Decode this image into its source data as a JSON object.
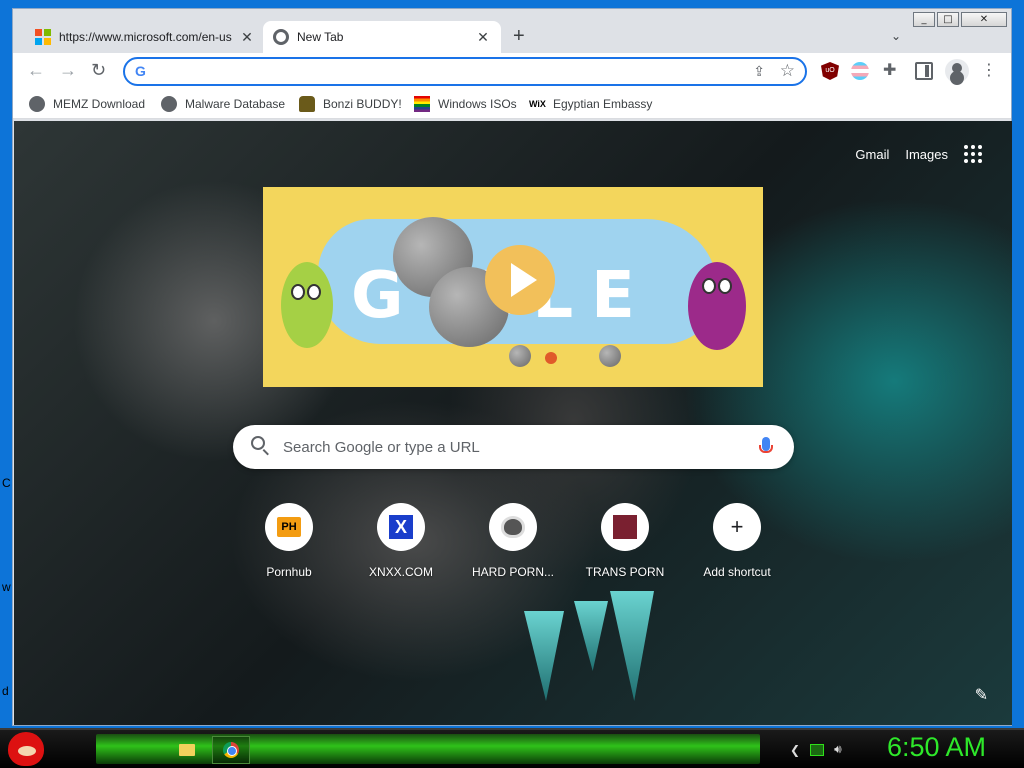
{
  "desktop": {
    "left_letters": [
      "C",
      "w",
      "d"
    ]
  },
  "window": {
    "controls": [
      "_",
      "□",
      "✕"
    ]
  },
  "tabs": [
    {
      "title": "https://www.microsoft.com/en-us",
      "active": false
    },
    {
      "title": "New Tab",
      "active": true
    }
  ],
  "omnibox": {
    "value": "",
    "placeholder": ""
  },
  "bookmarks": [
    {
      "label": "MEMZ Download",
      "icon": "globe-icon"
    },
    {
      "label": "Malware Database",
      "icon": "globe-icon"
    },
    {
      "label": "Bonzi BUDDY!",
      "icon": "bonzi-icon"
    },
    {
      "label": "Windows ISOs",
      "icon": "rainbow-flag-icon"
    },
    {
      "label": "Egyptian Embassy",
      "icon": "wix-icon"
    }
  ],
  "newtab": {
    "top_links": {
      "gmail": "Gmail",
      "images": "Images"
    },
    "search": {
      "placeholder": "Search Google or type a URL"
    },
    "shortcuts": [
      {
        "label": "Pornhub",
        "icon_text": "PH"
      },
      {
        "label": "XNXX.COM",
        "icon_text": "X"
      },
      {
        "label": "HARD PORN...",
        "icon_text": ""
      },
      {
        "label": "TRANS PORN",
        "icon_text": ""
      },
      {
        "label": "Add shortcut",
        "icon_text": "+"
      }
    ]
  },
  "taskbar": {
    "clock": "6:50 AM"
  },
  "colors": {
    "accent": "#1a73e8",
    "taskbar_glow": "#2fc21a",
    "clock": "#2ee82a"
  }
}
